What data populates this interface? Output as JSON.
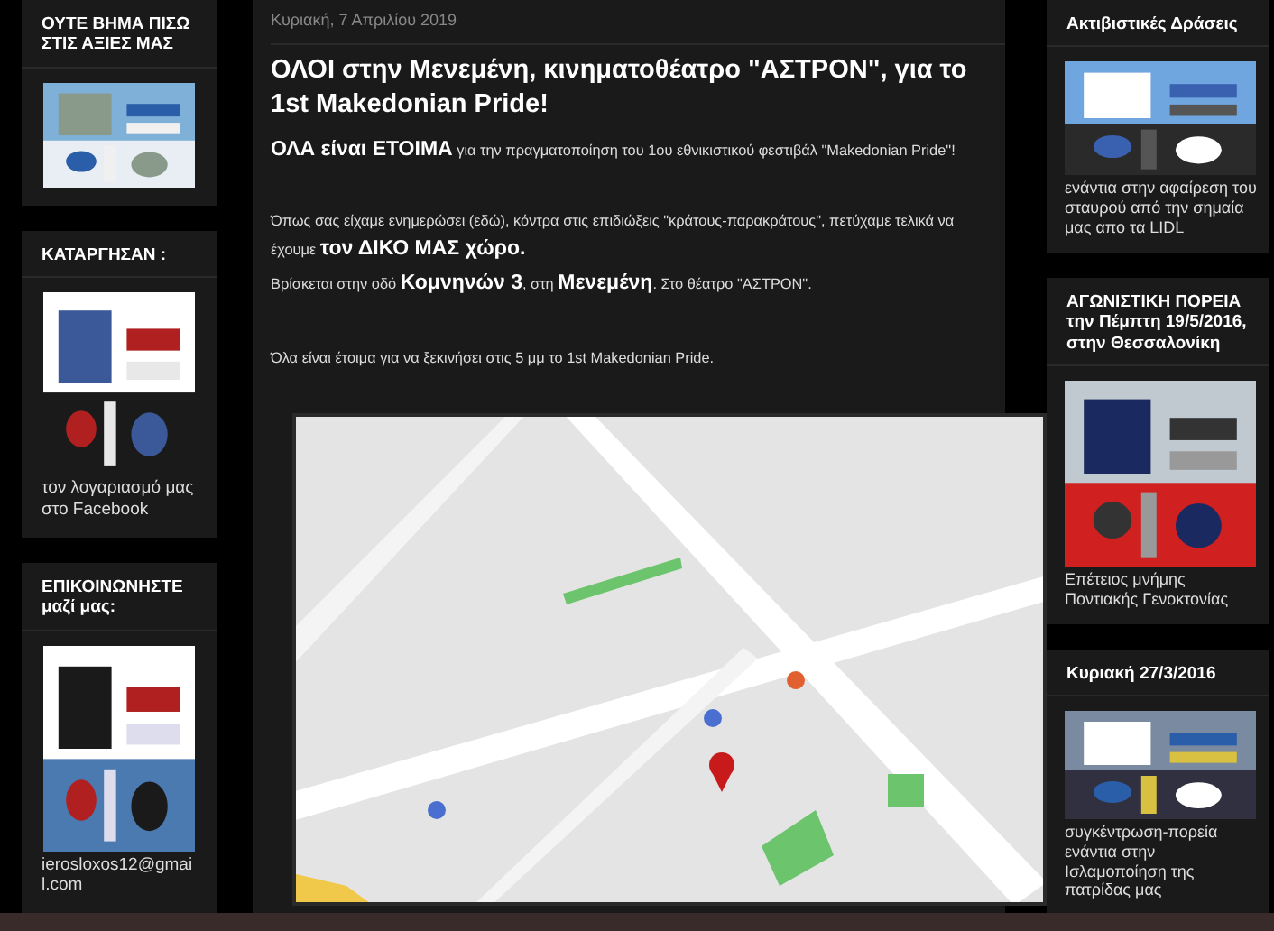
{
  "left_sidebar": [
    {
      "title": "ΟΥΤΕ ΒΗΜΑ ΠΙΣΩ ΣΤΙΣ ΑΞΙΕΣ ΜΑΣ"
    },
    {
      "title": "ΚΑΤΑΡΓΗΣΑΝ :",
      "caption": "τον λογαριασμό μας στο Facebook"
    },
    {
      "title": "ΕΠΙΚΟΙΝΩΝΗΣΤΕ μαζί μας:",
      "caption": "ierosloxos12@gmai l.com"
    }
  ],
  "post": {
    "date": "Κυριακή, 7 Απριλίου 2019",
    "title": "ΟΛΟΙ στην Μενεμένη, κινηματοθέατρο \"ΑΣΤΡΟΝ\", για το 1st Makedonian Pride!",
    "paragraphs": [
      "**ΟΛΑ είναι ΕΤΟΙΜΑ** για την πραγματοποίηση του 1ου εθνικιστικού φεστιβάλ \"Makedonian Pride\"!",
      "Όπως σας είχαμε ενημερώσει (εδώ), κόντρα στις επιδιώξεις \"κράτους-παρακράτους\", πετύχαμε τελικά να έχουμε  **τον ΔΙΚΟ ΜΑΣ χώρο.**",
      "Βρίσκεται στην οδό **Κομνηνών 3**, στη **Μενεμένη**. Στο θέατρο \"ΑΣΤΡΟΝ\".",
      "Όλα είναι έτοιμα για να ξεκινήσει στις 5 μμ το 1st Makedonian Pride."
    ]
  },
  "right_sidebar": [
    {
      "title": "Ακτιβιστικές Δράσεις",
      "caption": "ενάντια στην αφαίρεση του σταυρού από την σημαία μας απο τα LIDL"
    },
    {
      "title": "ΑΓΩΝΙΣΤΙΚΗ ΠΟΡΕΙΑ την Πέμπτη 19/5/2016, στην Θεσσαλονίκη",
      "caption": "Επέτειος μνήμης Ποντιακής Γενοκτονίας"
    },
    {
      "title": "Κυριακή 27/3/2016",
      "caption": "συγκέντρωση-πορεία ενάντια στην Ισλαμοποίηση της πατρίδας μας"
    }
  ]
}
